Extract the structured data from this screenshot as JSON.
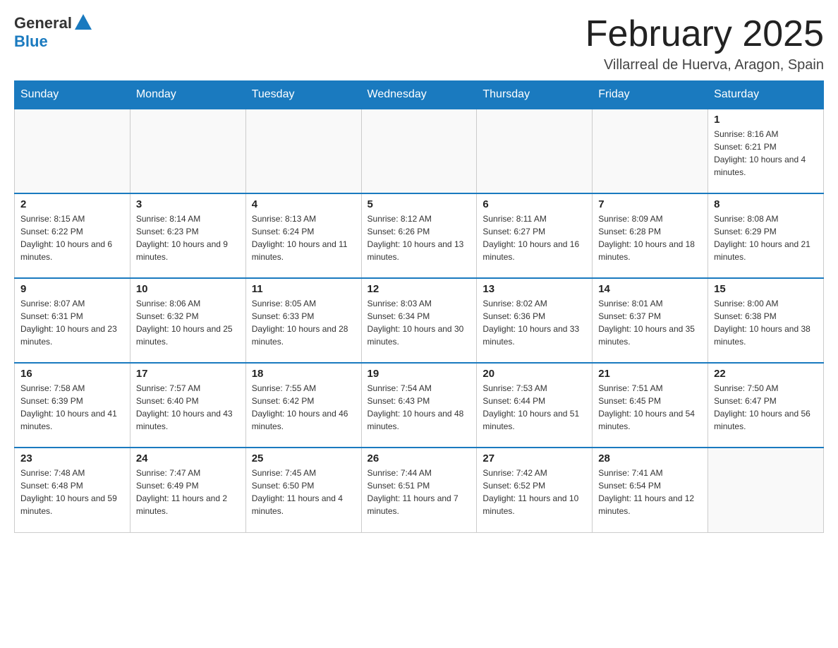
{
  "logo": {
    "general": "General",
    "blue": "Blue"
  },
  "title": "February 2025",
  "location": "Villarreal de Huerva, Aragon, Spain",
  "weekdays": [
    "Sunday",
    "Monday",
    "Tuesday",
    "Wednesday",
    "Thursday",
    "Friday",
    "Saturday"
  ],
  "weeks": [
    [
      {
        "day": "",
        "info": ""
      },
      {
        "day": "",
        "info": ""
      },
      {
        "day": "",
        "info": ""
      },
      {
        "day": "",
        "info": ""
      },
      {
        "day": "",
        "info": ""
      },
      {
        "day": "",
        "info": ""
      },
      {
        "day": "1",
        "info": "Sunrise: 8:16 AM\nSunset: 6:21 PM\nDaylight: 10 hours and 4 minutes."
      }
    ],
    [
      {
        "day": "2",
        "info": "Sunrise: 8:15 AM\nSunset: 6:22 PM\nDaylight: 10 hours and 6 minutes."
      },
      {
        "day": "3",
        "info": "Sunrise: 8:14 AM\nSunset: 6:23 PM\nDaylight: 10 hours and 9 minutes."
      },
      {
        "day": "4",
        "info": "Sunrise: 8:13 AM\nSunset: 6:24 PM\nDaylight: 10 hours and 11 minutes."
      },
      {
        "day": "5",
        "info": "Sunrise: 8:12 AM\nSunset: 6:26 PM\nDaylight: 10 hours and 13 minutes."
      },
      {
        "day": "6",
        "info": "Sunrise: 8:11 AM\nSunset: 6:27 PM\nDaylight: 10 hours and 16 minutes."
      },
      {
        "day": "7",
        "info": "Sunrise: 8:09 AM\nSunset: 6:28 PM\nDaylight: 10 hours and 18 minutes."
      },
      {
        "day": "8",
        "info": "Sunrise: 8:08 AM\nSunset: 6:29 PM\nDaylight: 10 hours and 21 minutes."
      }
    ],
    [
      {
        "day": "9",
        "info": "Sunrise: 8:07 AM\nSunset: 6:31 PM\nDaylight: 10 hours and 23 minutes."
      },
      {
        "day": "10",
        "info": "Sunrise: 8:06 AM\nSunset: 6:32 PM\nDaylight: 10 hours and 25 minutes."
      },
      {
        "day": "11",
        "info": "Sunrise: 8:05 AM\nSunset: 6:33 PM\nDaylight: 10 hours and 28 minutes."
      },
      {
        "day": "12",
        "info": "Sunrise: 8:03 AM\nSunset: 6:34 PM\nDaylight: 10 hours and 30 minutes."
      },
      {
        "day": "13",
        "info": "Sunrise: 8:02 AM\nSunset: 6:36 PM\nDaylight: 10 hours and 33 minutes."
      },
      {
        "day": "14",
        "info": "Sunrise: 8:01 AM\nSunset: 6:37 PM\nDaylight: 10 hours and 35 minutes."
      },
      {
        "day": "15",
        "info": "Sunrise: 8:00 AM\nSunset: 6:38 PM\nDaylight: 10 hours and 38 minutes."
      }
    ],
    [
      {
        "day": "16",
        "info": "Sunrise: 7:58 AM\nSunset: 6:39 PM\nDaylight: 10 hours and 41 minutes."
      },
      {
        "day": "17",
        "info": "Sunrise: 7:57 AM\nSunset: 6:40 PM\nDaylight: 10 hours and 43 minutes."
      },
      {
        "day": "18",
        "info": "Sunrise: 7:55 AM\nSunset: 6:42 PM\nDaylight: 10 hours and 46 minutes."
      },
      {
        "day": "19",
        "info": "Sunrise: 7:54 AM\nSunset: 6:43 PM\nDaylight: 10 hours and 48 minutes."
      },
      {
        "day": "20",
        "info": "Sunrise: 7:53 AM\nSunset: 6:44 PM\nDaylight: 10 hours and 51 minutes."
      },
      {
        "day": "21",
        "info": "Sunrise: 7:51 AM\nSunset: 6:45 PM\nDaylight: 10 hours and 54 minutes."
      },
      {
        "day": "22",
        "info": "Sunrise: 7:50 AM\nSunset: 6:47 PM\nDaylight: 10 hours and 56 minutes."
      }
    ],
    [
      {
        "day": "23",
        "info": "Sunrise: 7:48 AM\nSunset: 6:48 PM\nDaylight: 10 hours and 59 minutes."
      },
      {
        "day": "24",
        "info": "Sunrise: 7:47 AM\nSunset: 6:49 PM\nDaylight: 11 hours and 2 minutes."
      },
      {
        "day": "25",
        "info": "Sunrise: 7:45 AM\nSunset: 6:50 PM\nDaylight: 11 hours and 4 minutes."
      },
      {
        "day": "26",
        "info": "Sunrise: 7:44 AM\nSunset: 6:51 PM\nDaylight: 11 hours and 7 minutes."
      },
      {
        "day": "27",
        "info": "Sunrise: 7:42 AM\nSunset: 6:52 PM\nDaylight: 11 hours and 10 minutes."
      },
      {
        "day": "28",
        "info": "Sunrise: 7:41 AM\nSunset: 6:54 PM\nDaylight: 11 hours and 12 minutes."
      },
      {
        "day": "",
        "info": ""
      }
    ]
  ]
}
